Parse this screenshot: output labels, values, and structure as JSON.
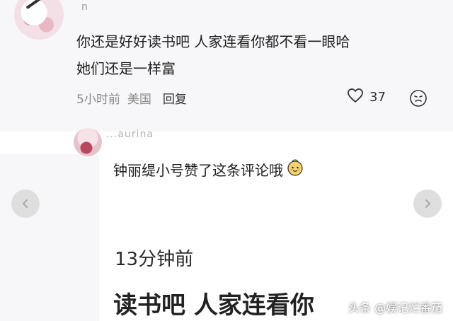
{
  "comment1": {
    "username_fragment": "n",
    "text_line1": "你还是好好读书吧 人家连看你都不看一眼哈",
    "text_line2": "她们还是一样富",
    "time": "5小时前",
    "location": "美国",
    "reply_label": "回复",
    "likes": "37"
  },
  "comment2": {
    "username_fragment": "...aurina",
    "text": "钟丽缇小号赞了这条评论哦",
    "emoji_icon": "sticker-face-icon"
  },
  "overlay": {
    "time": "13分钟前",
    "snippet": "读书吧 人家连看你"
  },
  "watermark": "头条 @娱记烂番茄",
  "colors": {
    "background": "#f7f7f9",
    "panel": "#ffffff",
    "meta_text": "#8a8a8a",
    "nav_button": "#dedede"
  }
}
